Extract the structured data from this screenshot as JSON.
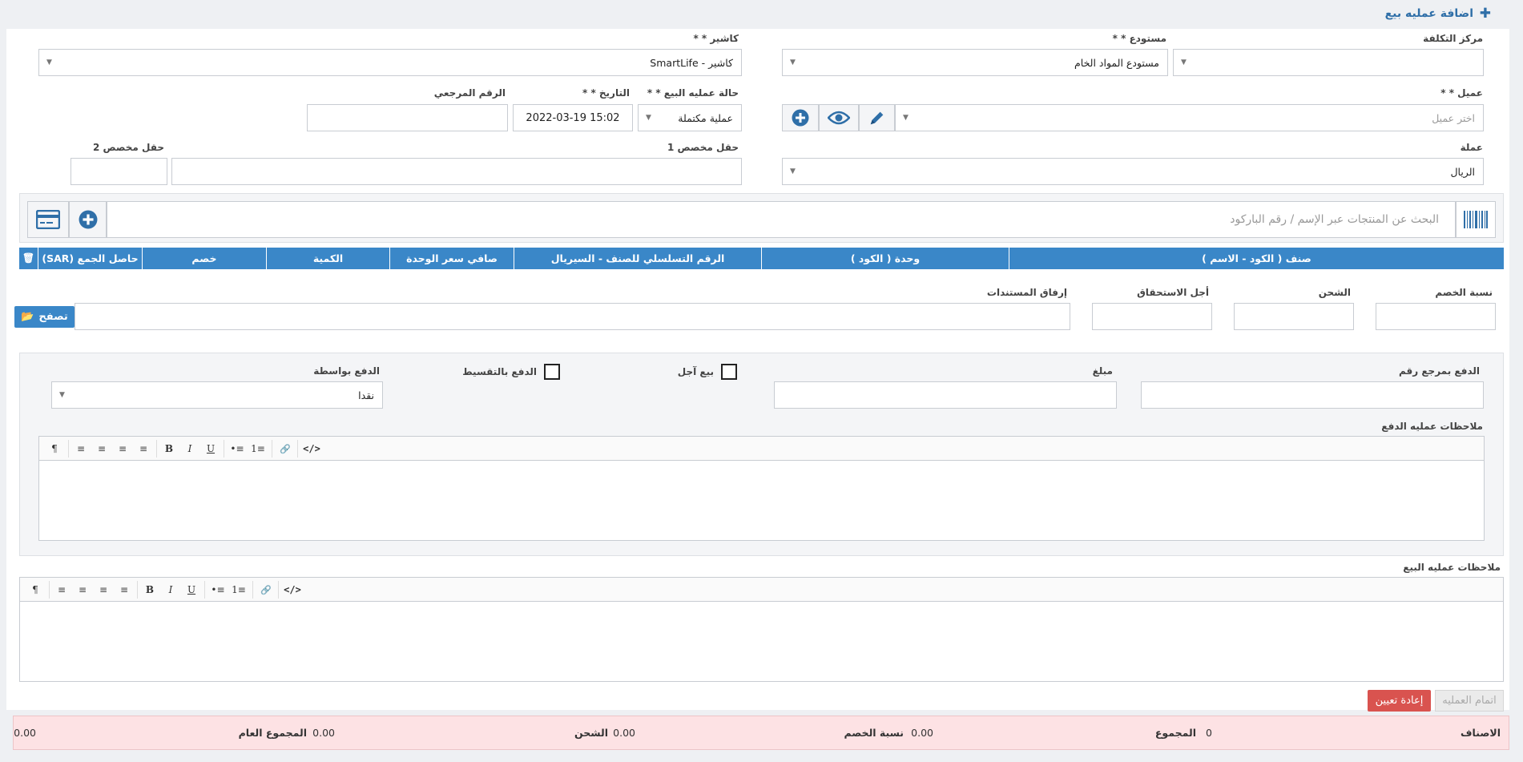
{
  "header": {
    "title": "اضافة عمليه بيع",
    "plus_icon": "plus-icon"
  },
  "form": {
    "cost_center": {
      "label": "مركز التكلفة",
      "value": ""
    },
    "warehouse": {
      "label": "مستودع * *",
      "value": "مستودع المواد الخام"
    },
    "cashier": {
      "label": "كاشير * *",
      "value": "كاشير - SmartLife"
    },
    "customer": {
      "label": "عميل * *",
      "placeholder": "اختر عميل"
    },
    "sale_status": {
      "label": "حالة عمليه البيع * *",
      "value": "عملية مكتملة"
    },
    "date": {
      "label": "التاريخ * *",
      "value": "2022-03-19 15:02"
    },
    "reference": {
      "label": "الرقم المرجعي",
      "value": ""
    },
    "currency": {
      "label": "عملة",
      "value": "الريال"
    },
    "custom1": {
      "label": "حقل مخصص 1",
      "value": ""
    },
    "custom2": {
      "label": "حقل مخصص 2",
      "value": ""
    }
  },
  "search": {
    "placeholder": "البحث عن المنتجات عبر الإسم / رقم الباركود"
  },
  "table": {
    "headers": [
      "صنف ( الكود - الاسم )",
      "وحدة ( الكود )",
      "الرقم التسلسلي للصنف - السيريال",
      "صافي سعر الوحدة",
      "الكمية",
      "خصم",
      "حاصل الجمع (SAR)"
    ],
    "trash_icon": "trash-icon",
    "header_color": "#3a87c8"
  },
  "extras": {
    "discount_pct": {
      "label": "نسبة الخصم",
      "value": ""
    },
    "shipping": {
      "label": "الشحن",
      "value": ""
    },
    "due_term": {
      "label": "أجل الاستحقاق",
      "value": ""
    },
    "attach": {
      "label": "إرفاق المستندات",
      "value": ""
    },
    "browse_label": "تصفح"
  },
  "payment": {
    "ref_no": {
      "label": "الدفع بمرجع رقم",
      "value": ""
    },
    "amount": {
      "label": "مبلغ",
      "value": ""
    },
    "deferred": {
      "label": "بيع آجل"
    },
    "installment": {
      "label": "الدفع بالتقسيط"
    },
    "method": {
      "label": "الدفع بواسطة",
      "value": "نقدا"
    },
    "notes_label": "ملاحظات عمليه الدفع"
  },
  "sale_notes_label": "ملاحظات عمليه البيع",
  "editor_tools": [
    "¶",
    "≡",
    "≡",
    "≡",
    "≡",
    "B",
    "I",
    "U",
    "•≡",
    "1≡",
    "🔗",
    "</>"
  ],
  "actions": {
    "complete": "اتمام العمليه",
    "reset": "إعادة تعيين",
    "reset_color": "#d9534f"
  },
  "totals": {
    "items": {
      "label": "الاصناف",
      "value": "0"
    },
    "sum": {
      "label": "المجموع",
      "value": "0.00"
    },
    "discount": {
      "label": "نسبة الخصم",
      "value": "0.00"
    },
    "shipping": {
      "label": "الشحن",
      "value": "0.00"
    },
    "grand": {
      "label": "المجموع العام",
      "value": "0.00"
    },
    "bg_color": "#fde2e4"
  }
}
